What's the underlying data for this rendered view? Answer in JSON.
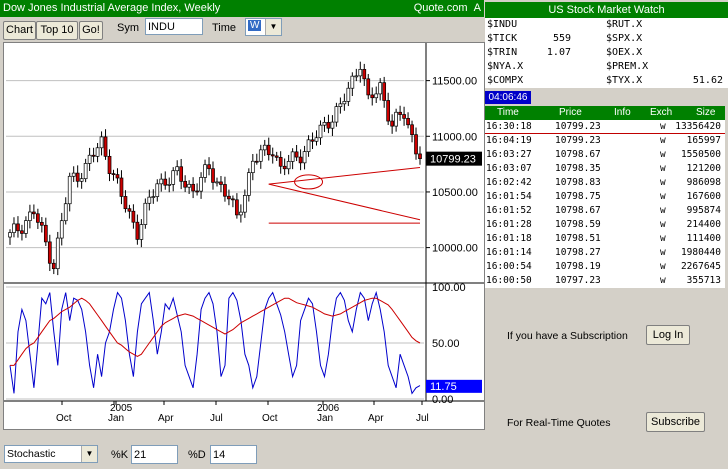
{
  "window": {
    "title": "Dow Jones Industrial Average Index, Weekly",
    "brand": "Quote.com"
  },
  "toolbar": {
    "chart_btn": "Chart",
    "top10_btn": "Top 10",
    "go_btn": "Go!",
    "sym_label": "Sym",
    "sym_value": "INDU",
    "time_label": "Time",
    "time_value": "W"
  },
  "chart_data": [
    {
      "type": "candlestick",
      "title": "Dow Jones Industrial Average Index, Weekly",
      "y_ticks": [
        "11500.00",
        "11000.00",
        "10500.00",
        "10000.00"
      ],
      "ylim": [
        9700,
        11820
      ],
      "last_value": "10799.23",
      "x_ticks": [
        "Oct",
        "2005",
        "Jan",
        "Apr",
        "Jul",
        "Oct",
        "2006",
        "Jan",
        "Apr",
        "Jul"
      ],
      "weeks": 104,
      "close_path": [
        [
          0,
          10100
        ],
        [
          6,
          10320
        ],
        [
          11,
          9850
        ],
        [
          15,
          10600
        ],
        [
          19,
          10720
        ],
        [
          23,
          10950
        ],
        [
          28,
          10450
        ],
        [
          32,
          10150
        ],
        [
          37,
          10580
        ],
        [
          42,
          10650
        ],
        [
          46,
          10520
        ],
        [
          50,
          10700
        ],
        [
          55,
          10450
        ],
        [
          57,
          10250
        ],
        [
          61,
          10780
        ],
        [
          66,
          10900
        ],
        [
          68,
          10700
        ],
        [
          73,
          10850
        ],
        [
          76,
          10950
        ],
        [
          80,
          11150
        ],
        [
          83,
          11250
        ],
        [
          86,
          11500
        ],
        [
          88,
          11680
        ],
        [
          90,
          11300
        ],
        [
          93,
          11450
        ],
        [
          96,
          11100
        ],
        [
          99,
          11200
        ],
        [
          102,
          10900
        ],
        [
          103,
          10799
        ]
      ],
      "trendlines": [
        [
          [
            65,
            10570
          ],
          [
            103,
            10720
          ]
        ],
        [
          [
            65,
            10570
          ],
          [
            103,
            10250
          ]
        ],
        [
          [
            65,
            10220
          ],
          [
            103,
            10220
          ]
        ]
      ]
    },
    {
      "type": "line",
      "title": "Stochastic",
      "y_ticks": [
        "100.00",
        "50.00",
        "0.00"
      ],
      "ylim": [
        0,
        100
      ],
      "last_value": "11.75",
      "series": [
        {
          "name": "%K",
          "color": "#0000cc",
          "values": [
            30,
            5,
            60,
            80,
            70,
            40,
            10,
            50,
            90,
            85,
            95,
            60,
            30,
            80,
            95,
            70,
            90,
            88,
            80,
            60,
            30,
            10,
            40,
            20,
            50,
            60,
            80,
            95,
            90,
            70,
            40,
            20,
            60,
            85,
            90,
            95,
            70,
            40,
            60,
            85,
            80,
            90,
            75,
            60,
            30,
            20,
            10,
            40,
            80,
            90,
            95,
            85,
            60,
            20,
            30,
            90,
            95,
            88,
            70,
            40,
            30,
            10,
            20,
            50,
            80,
            90,
            95,
            85,
            75,
            60,
            40,
            20,
            30,
            70,
            80,
            90,
            85,
            60,
            30,
            20,
            40,
            70,
            90,
            95,
            88,
            70,
            60,
            80,
            95,
            90,
            70,
            85,
            95,
            80,
            60,
            30,
            20,
            10,
            40,
            30,
            20,
            5,
            10,
            12
          ]
        },
        {
          "name": "%D",
          "color": "#cc0000",
          "values": [
            30,
            30,
            35,
            40,
            45,
            48,
            50,
            55,
            60,
            65,
            70,
            72,
            75,
            78,
            80,
            82,
            85,
            88,
            90,
            88,
            85,
            80,
            75,
            70,
            65,
            60,
            55,
            50,
            48,
            45,
            42,
            40,
            38,
            40,
            45,
            50,
            55,
            60,
            65,
            68,
            70,
            72,
            74,
            75,
            76,
            75,
            74,
            72,
            70,
            68,
            66,
            64,
            62,
            60,
            58,
            60,
            62,
            65,
            68,
            70,
            72,
            74,
            76,
            78,
            80,
            82,
            84,
            86,
            88,
            90,
            90,
            88,
            86,
            85,
            84,
            83,
            82,
            80,
            78,
            76,
            75,
            74,
            75,
            76,
            78,
            80,
            82,
            84,
            86,
            88,
            89,
            90,
            90,
            88,
            86,
            84,
            80,
            75,
            70,
            65,
            60,
            55,
            52,
            50
          ]
        }
      ]
    }
  ],
  "panel": {
    "title": "US Stock Market Watch",
    "clock": "04:06:46",
    "watch": [
      {
        "sym": "$INDU",
        "val": "",
        "sym2": "$RUT.X",
        "val2": ""
      },
      {
        "sym": "$TICK",
        "val": "559",
        "sym2": "$SPX.X",
        "val2": ""
      },
      {
        "sym": "$TRIN",
        "val": "1.07",
        "sym2": "$OEX.X",
        "val2": ""
      },
      {
        "sym": "$NYA.X",
        "val": "",
        "sym2": "$PREM.X",
        "val2": ""
      },
      {
        "sym": "$COMPX",
        "val": "",
        "sym2": "$TYX.X",
        "val2": "51.62"
      }
    ],
    "columns": [
      "Time",
      "Price",
      "Info",
      "Exch",
      "Size"
    ],
    "trades": [
      {
        "time": "16:30:18",
        "price": "10799.23",
        "info": "",
        "exch": "w",
        "size": "13356420"
      },
      {
        "time": "16:04:19",
        "price": "10799.23",
        "info": "",
        "exch": "w",
        "size": "165997"
      },
      {
        "time": "16:03:27",
        "price": "10798.67",
        "info": "",
        "exch": "w",
        "size": "1550500"
      },
      {
        "time": "16:03:07",
        "price": "10798.35",
        "info": "",
        "exch": "w",
        "size": "121200"
      },
      {
        "time": "16:02:42",
        "price": "10798.83",
        "info": "",
        "exch": "w",
        "size": "986098"
      },
      {
        "time": "16:01:54",
        "price": "10798.75",
        "info": "",
        "exch": "w",
        "size": "167600"
      },
      {
        "time": "16:01:52",
        "price": "10798.67",
        "info": "",
        "exch": "w",
        "size": "995874"
      },
      {
        "time": "16:01:28",
        "price": "10798.59",
        "info": "",
        "exch": "w",
        "size": "214400"
      },
      {
        "time": "16:01:18",
        "price": "10798.51",
        "info": "",
        "exch": "w",
        "size": "111400"
      },
      {
        "time": "16:01:14",
        "price": "10798.27",
        "info": "",
        "exch": "w",
        "size": "1980440"
      },
      {
        "time": "16:00:54",
        "price": "10798.19",
        "info": "",
        "exch": "w",
        "size": "2267645"
      },
      {
        "time": "16:00:50",
        "price": "10797.23",
        "info": "",
        "exch": "w",
        "size": "355713"
      }
    ],
    "subscription_text": "If you have a Subscription",
    "login_btn": "Log In",
    "realtime_text": "For Real-Time Quotes",
    "subscribe_btn": "Subscribe"
  },
  "bottom": {
    "study_value": "Stochastic",
    "k_label": "%K",
    "k_value": "21",
    "d_label": "%D",
    "d_value": "14"
  },
  "colors": {
    "green": "#008000",
    "up_candle": "#ffffff",
    "down_candle": "#cc0000",
    "trendline": "#cc0000"
  }
}
